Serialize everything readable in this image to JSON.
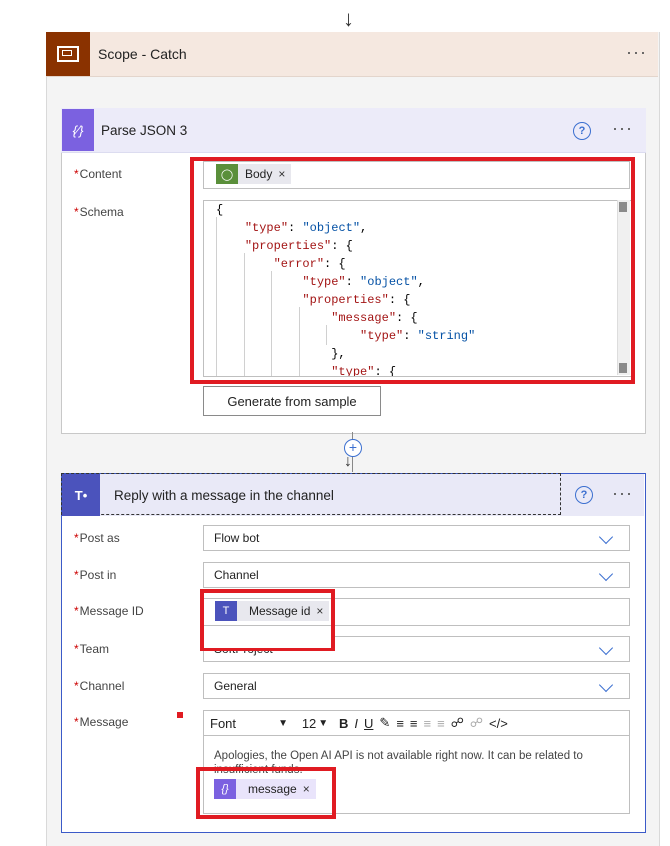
{
  "scope": {
    "title": "Scope - Catch",
    "more": "···",
    "accent": "#8a3200"
  },
  "parse": {
    "title": "Parse JSON 3",
    "help": "?",
    "more": "···",
    "content_label": "Content",
    "content_token": "Body",
    "schema_label": "Schema",
    "schema_lines": [
      "{",
      "    \"type\": \"object\",",
      "    \"properties\": {",
      "        \"error\": {",
      "            \"type\": \"object\",",
      "            \"properties\": {",
      "                \"message\": {",
      "                    \"type\": \"string\"",
      "                },",
      "                \"type\": {"
    ],
    "generate_button": "Generate from sample"
  },
  "add": {
    "plus": "+"
  },
  "reply": {
    "title": "Reply with a message in the channel",
    "help": "?",
    "more": "···",
    "post_as_label": "Post as",
    "post_as_value": "Flow bot",
    "post_in_label": "Post in",
    "post_in_value": "Channel",
    "message_id_label": "Message ID",
    "message_id_token": "Message id",
    "team_label": "Team",
    "team_value": "SoftProject",
    "channel_label": "Channel",
    "channel_value": "General",
    "message_label": "Message",
    "toolbar": {
      "font": "Font",
      "size": "12"
    },
    "message_text": "Apologies, the Open AI API is not available right now. It can be related to insufficient funds.",
    "message_token": "message",
    "accent": "#4b53bc"
  },
  "required_mark": "*",
  "token_remove": "×"
}
